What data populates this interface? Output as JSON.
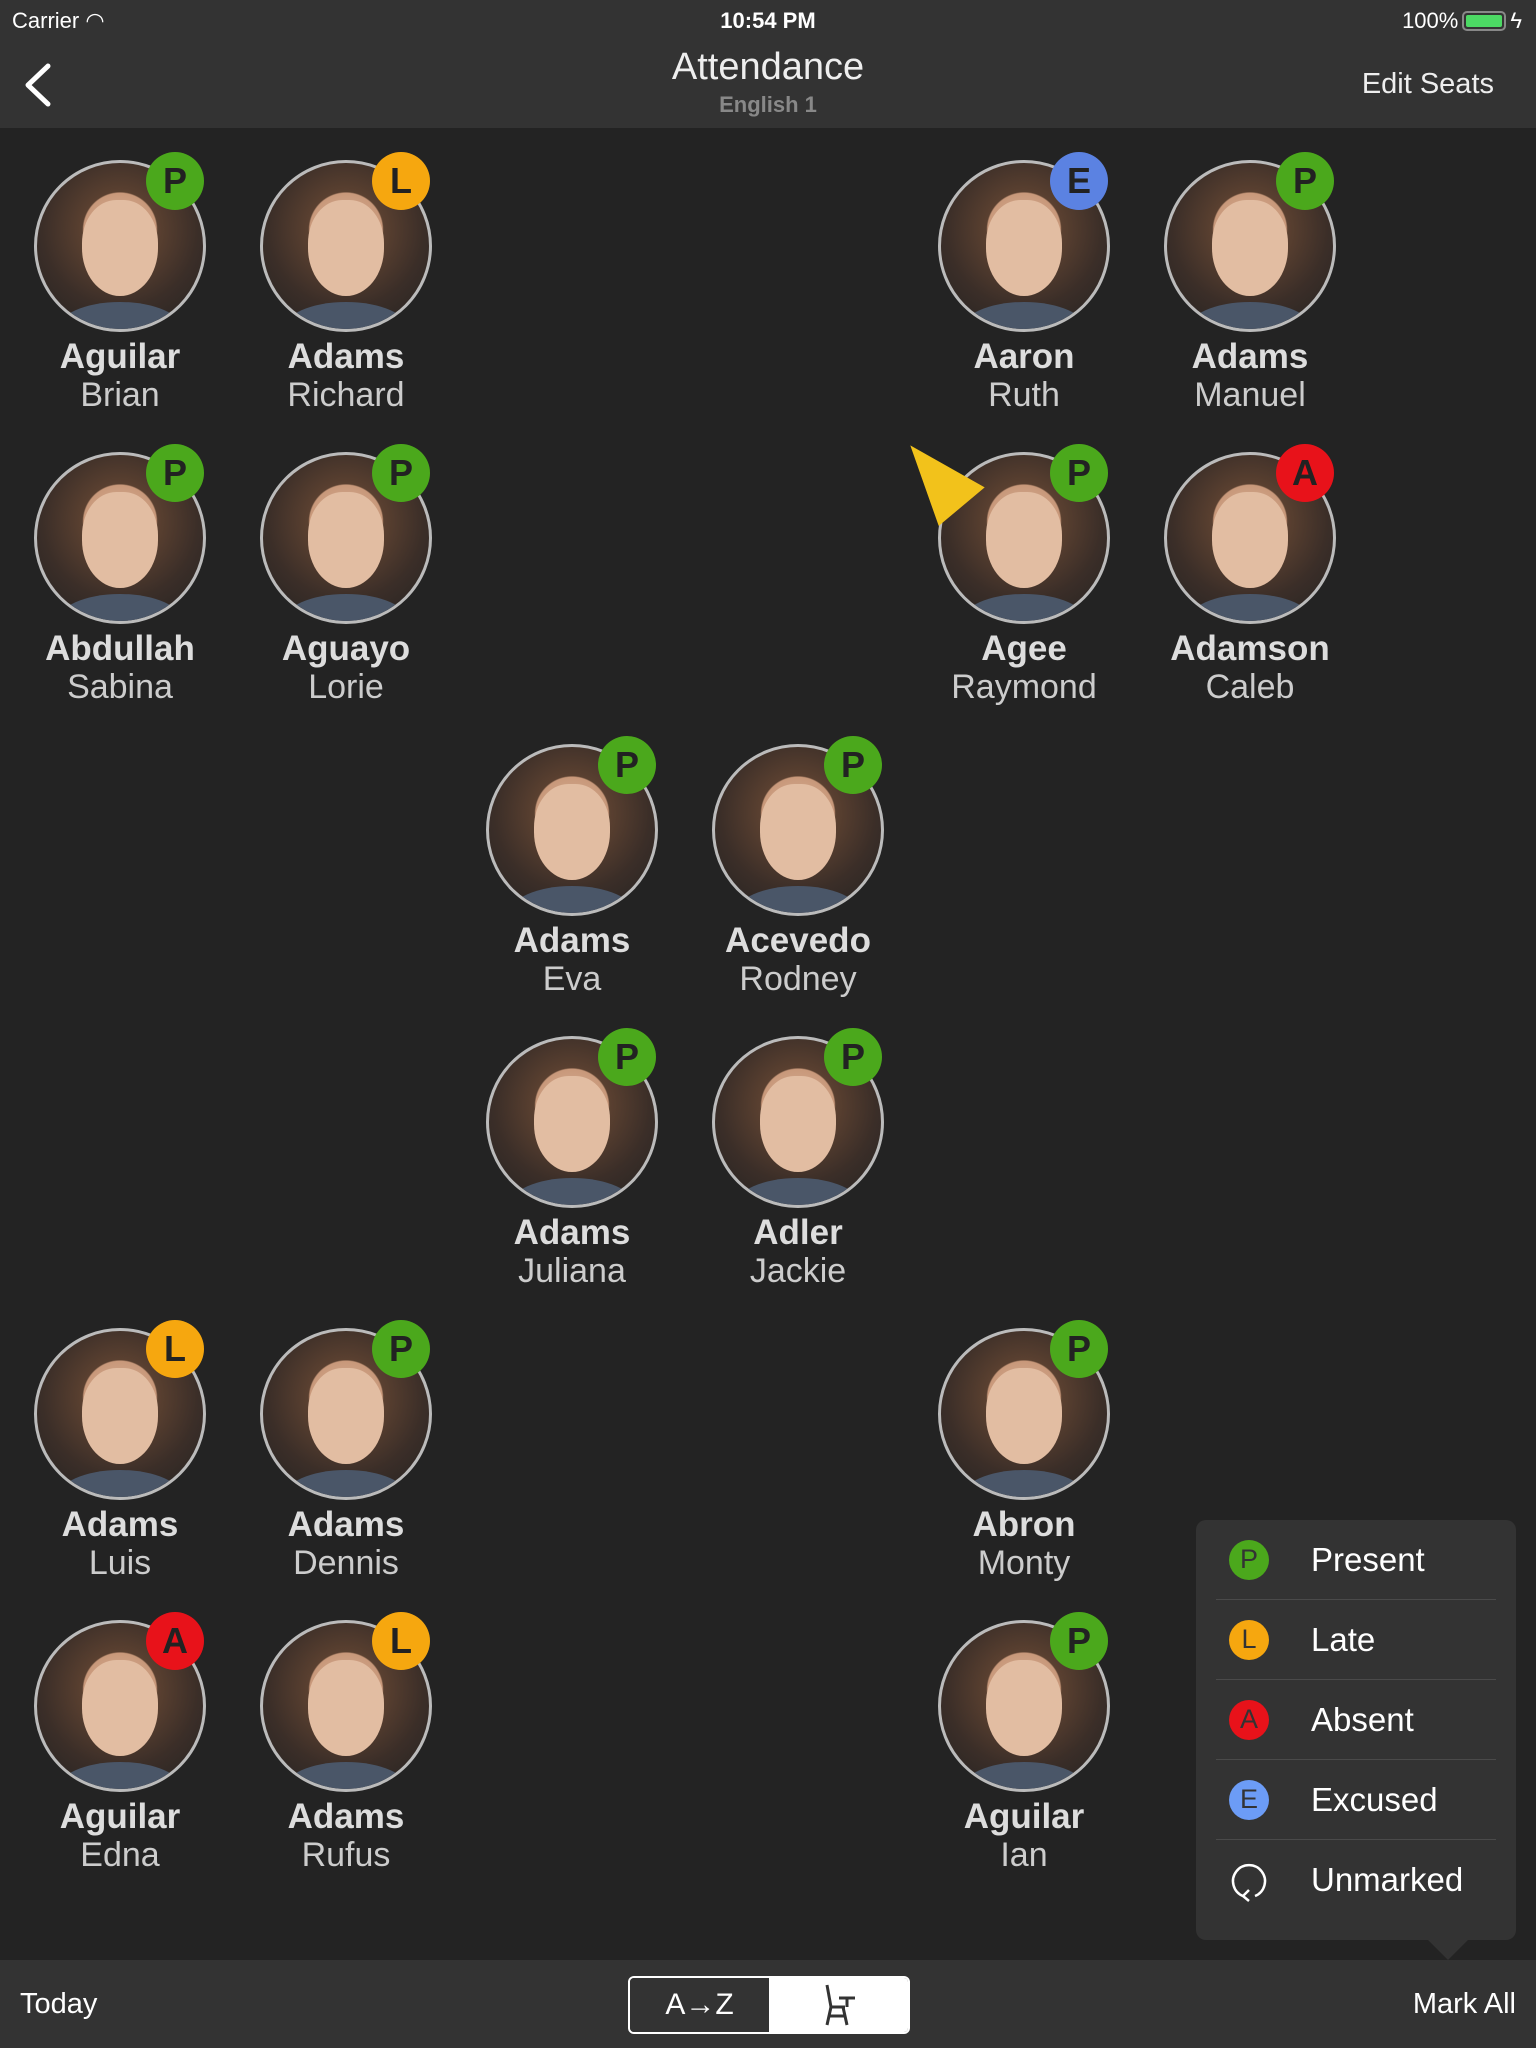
{
  "status_bar": {
    "carrier": "Carrier",
    "time": "10:54 PM",
    "battery": "100%"
  },
  "nav": {
    "title": "Attendance",
    "subtitle": "English 1",
    "edit_label": "Edit Seats"
  },
  "colors": {
    "present": "#4ba81c",
    "late": "#f6a70f",
    "absent": "#e8121a",
    "excused": "#5b82e2",
    "excused_menu": "#6c9cf6"
  },
  "students": [
    {
      "last": "Aguilar",
      "first": "Brian",
      "status": "P"
    },
    {
      "last": "Adams",
      "first": "Richard",
      "status": "L"
    },
    {
      "last": "Aaron",
      "first": "Ruth",
      "status": "E"
    },
    {
      "last": "Adams",
      "first": "Manuel",
      "status": "P"
    },
    {
      "last": "Abdullah",
      "first": "Sabina",
      "status": "P"
    },
    {
      "last": "Aguayo",
      "first": "Lorie",
      "status": "P"
    },
    {
      "last": "Agee",
      "first": "Raymond",
      "status": "P",
      "birthday": true
    },
    {
      "last": "Adamson",
      "first": "Caleb",
      "status": "A"
    },
    {
      "last": "Adams",
      "first": "Eva",
      "status": "P"
    },
    {
      "last": "Acevedo",
      "first": "Rodney",
      "status": "P"
    },
    {
      "last": "Adams",
      "first": "Juliana",
      "status": "P"
    },
    {
      "last": "Adler",
      "first": "Jackie",
      "status": "P"
    },
    {
      "last": "Adams",
      "first": "Luis",
      "status": "L"
    },
    {
      "last": "Adams",
      "first": "Dennis",
      "status": "P"
    },
    {
      "last": "Abron",
      "first": "Monty",
      "status": "P"
    },
    {
      "last": "Aguilar",
      "first": "Edna",
      "status": "A"
    },
    {
      "last": "Adams",
      "first": "Rufus",
      "status": "L"
    },
    {
      "last": "Aguilar",
      "first": "Ian",
      "status": "P"
    }
  ],
  "menu": [
    {
      "letter": "P",
      "label": "Present",
      "icon": "present-badge"
    },
    {
      "letter": "L",
      "label": "Late",
      "icon": "late-badge"
    },
    {
      "letter": "A",
      "label": "Absent",
      "icon": "absent-badge"
    },
    {
      "letter": "E",
      "label": "Excused",
      "icon": "excused-badge"
    },
    {
      "letter": "",
      "label": "Unmarked",
      "icon": "reset-icon"
    }
  ],
  "bottom": {
    "today_label": "Today",
    "sort_label": "A→Z",
    "seat_icon": "desk-chair-icon",
    "mark_all_label": "Mark All"
  }
}
